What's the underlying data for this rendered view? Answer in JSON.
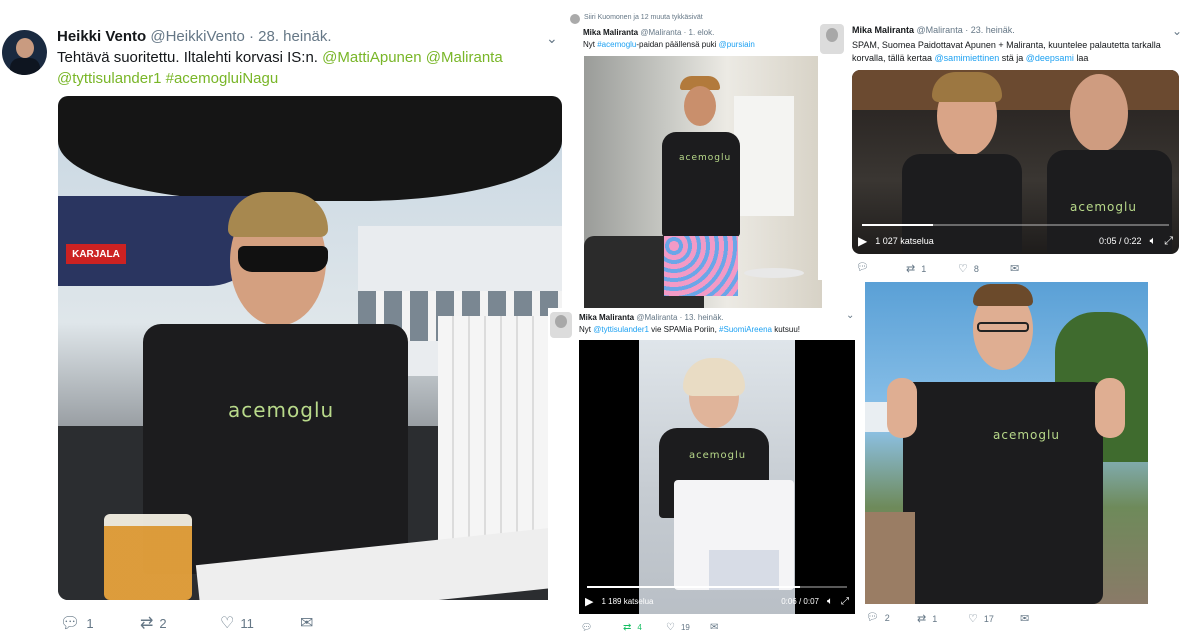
{
  "tweet_main": {
    "name": "Heikki Vento",
    "handle": "@HeikkiVento",
    "date": "· 28. heinäk.",
    "text": "Tehtävä suoritettu. Iltalehti korvasi IS:n.",
    "mentions": [
      "@MattiApunen",
      "@Maliranta",
      "@tyttisulander1"
    ],
    "hashtag": "#acemogluiNagu",
    "shirt_text": "acemoglu",
    "actions": {
      "reply": "1",
      "retweet": "2",
      "like": "11"
    }
  },
  "tweet_pursiain": {
    "liked_note": "Siiri Kuomonen ja 12 muuta tykkäsivät",
    "name": "Mika Maliranta",
    "handle": "@Maliranta",
    "date": "· 1. elok.",
    "text_pre": "Nyt ",
    "hashtag": "#acemoglu",
    "text_mid": "-paidan päällensä puki ",
    "mention": "@pursiain",
    "shirt_text": "acemoglu"
  },
  "tweet_spam_video": {
    "name": "Mika Maliranta",
    "handle": "@Maliranta",
    "date": "· 23. heinäk.",
    "text_pre": "SPAM, Suomea Paidottavat Apunen + Maliranta, kuuntelee palautetta tarkalla korvalla, tällä kertaa ",
    "mention1": "@samimiettinen",
    "text_mid": " stä ja ",
    "mention2": "@deepsami",
    "text_post": " laa",
    "shirt_text": "acemoglu",
    "video": {
      "views": "1 027 katselua",
      "time": "0:05 / 0:22",
      "progress": 0.23
    },
    "actions": {
      "retweet": "1",
      "like": "8"
    }
  },
  "tweet_pori": {
    "name": "Mika Maliranta",
    "handle": "@Maliranta",
    "date": "· 13. heinäk.",
    "text_pre": "Nyt ",
    "mention": "@tyttisulander1",
    "text_mid": " vie SPAMia Poriin, ",
    "hashtag": "#SuomiAreena",
    "text_post": " kutsuu!",
    "video": {
      "views": "1 189 katselua",
      "time": "0:06 / 0:07",
      "progress": 0.82
    },
    "actions": {
      "retweet": "4",
      "like": "19"
    }
  },
  "tweet_last": {
    "shirt_text": "acemoglu",
    "actions": {
      "reply": "2",
      "retweet": "1",
      "like": "17"
    }
  },
  "colors": {
    "link": "#1da1f2",
    "hashtag": "#79b628",
    "muted": "#657786",
    "retweet_green": "#17bf63"
  },
  "icons": [
    "reply-icon",
    "retweet-icon",
    "like-icon",
    "message-icon",
    "play-icon",
    "volume-icon",
    "fullscreen-icon",
    "chevron-down-icon"
  ]
}
